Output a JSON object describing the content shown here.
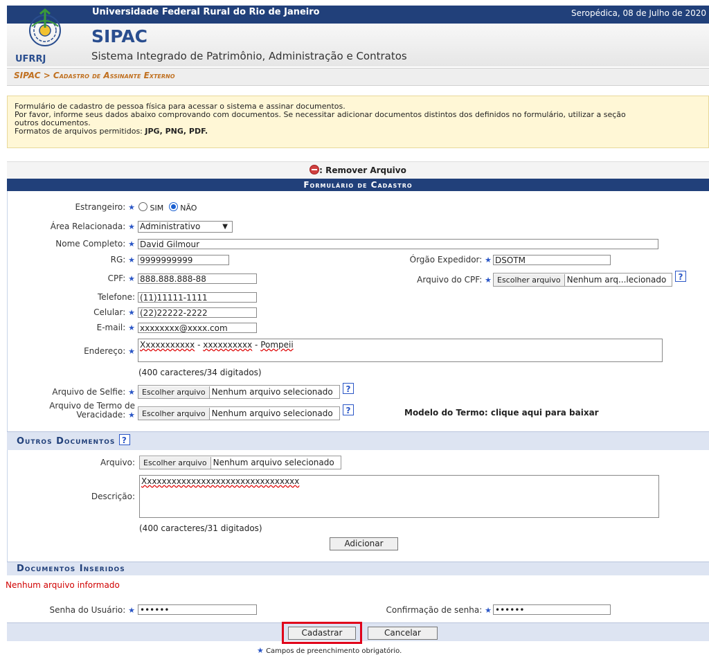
{
  "header": {
    "university": "Universidade Federal Rural do Rio de Janeiro",
    "date": "Seropédica, 08 de Julho de 2020",
    "logo_text": "UFRRJ",
    "system": "SIPAC",
    "system_full": "Sistema Integrado de Patrimônio, Administração e Contratos"
  },
  "breadcrumb": "SIPAC > Cadastro de Assinante Externo",
  "info": {
    "line1": "Formulário de cadastro de pessoa física para acessar o sistema e assinar documentos.",
    "line2": "Por favor, informe seus dados abaixo comprovando com documentos. Se necessitar adicionar documentos distintos dos definidos no formulário, utilizar a seção",
    "line3": "outros documentos.",
    "formats_label": "Formatos de arquivos permitidos:",
    "formats": "JPG, PNG, PDF."
  },
  "remove_legend": ": Remover Arquivo",
  "form": {
    "caption": "Formulário de Cadastro",
    "estrangeiro_label": "Estrangeiro:",
    "sim": "SIM",
    "nao": "NÃO",
    "area_label": "Área Relacionada:",
    "area_value": "Administrativo",
    "nome_label": "Nome Completo:",
    "nome_value": "David Gilmour",
    "rg_label": "RG:",
    "rg_value": "9999999999",
    "orgao_label": "Órgão Expedidor:",
    "orgao_value": "DSOTM",
    "cpf_label": "CPF:",
    "cpf_value": "888.888.888-88",
    "arq_cpf_label": "Arquivo do CPF:",
    "arq_cpf_file": "Nenhum arq...lecionado",
    "telefone_label": "Telefone:",
    "telefone_value": "(11)11111-1111",
    "celular_label": "Celular:",
    "celular_value": "(22)22222-2222",
    "email_label": "E-mail:",
    "email_value": "xxxxxxxx@xxxx.com",
    "endereco_label": "Endereço:",
    "endereco_value_a": "Xxxxxxxxxxx",
    "endereco_value_b": " - ",
    "endereco_value_c": "xxxxxxxxxx",
    "endereco_value_d": " - ",
    "endereco_value_e": "Pompeii",
    "endereco_count": "(400 caracteres/34 digitados)",
    "selfie_label": "Arquivo de Selfie:",
    "termo_label_1": "Arquivo de Termo de",
    "termo_label_2": "Veracidade:",
    "modelo_label": "Modelo do Termo:",
    "modelo_link": "clique aqui para baixar",
    "choose_file": "Escolher arquivo",
    "no_file": "Nenhum arquivo selecionado"
  },
  "outros": {
    "title": "Outros Documentos",
    "arquivo_label": "Arquivo:",
    "descricao_label": "Descrição:",
    "descricao_value": "Xxxxxxxxxxxxxxxxxxxxxxxxxxxxxxxx",
    "count": "(400 caracteres/31 digitados)",
    "add_button": "Adicionar"
  },
  "inseridos": {
    "title": "Documentos Inseridos",
    "empty": "Nenhum arquivo informado"
  },
  "senha": {
    "label": "Senha do Usuário:",
    "value": "••••••",
    "confirm_label": "Confirmação de senha:",
    "confirm_value": "••••••"
  },
  "buttons": {
    "submit": "Cadastrar",
    "cancel": "Cancelar"
  },
  "footnote": "Campos de preenchimento obrigatório.",
  "help_glyph": "?",
  "req_glyph": "★"
}
